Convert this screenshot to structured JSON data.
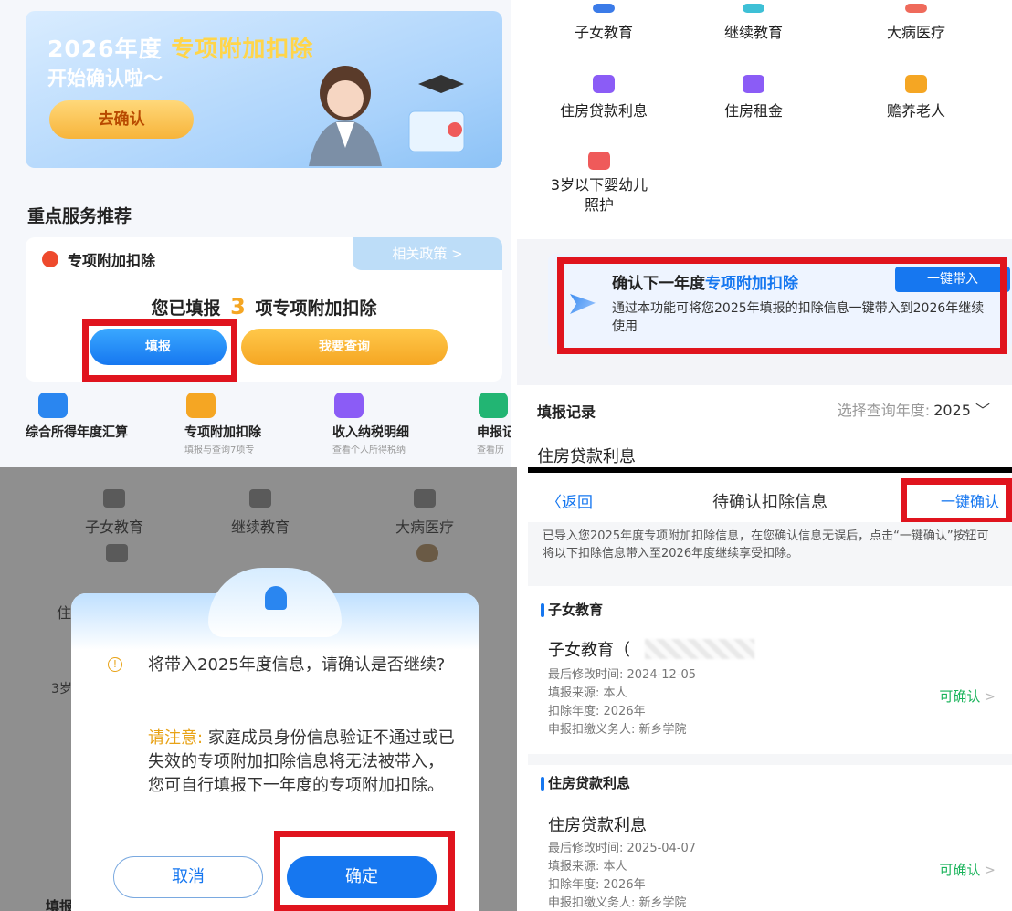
{
  "q1": {
    "banner_title_pre": "2026年度",
    "banner_title_hl": "专项附加扣除",
    "banner_sub": "开始确认啦～",
    "banner_btn": "去确认",
    "section_title": "重点服务推荐",
    "card_title": "专项附加扣除",
    "policy_link": "相关政策 >",
    "filled_pre": "您已填报",
    "filled_num": "3",
    "filled_post": "项专项附加扣除",
    "btn_fill": "填报",
    "btn_query": "我要查询",
    "tiles": [
      {
        "name": "综合所得年度汇算",
        "sub": "",
        "color": "#2a86f0"
      },
      {
        "name": "专项附加扣除",
        "sub": "填报与查询7项专",
        "color": "#f5a623"
      },
      {
        "name": "收入纳税明细",
        "sub": "查看个人所得税纳",
        "color": "#8b5cf6"
      },
      {
        "name": "申报记",
        "sub": "查看历",
        "color": "#22b573"
      }
    ]
  },
  "q2": {
    "cats": [
      "子女教育",
      "继续教育",
      "大病医疗",
      "住房贷款利息",
      "住房租金",
      "赡养老人",
      "3岁以下婴幼儿照护"
    ],
    "cat_colors": [
      "#3b7be8",
      "#3ec0d6",
      "#ef6a5b",
      "#8b5cf6",
      "#8b5cf6",
      "#f5a623",
      "#ef5a5a"
    ],
    "confirm_title_pre": "确认下一年度",
    "confirm_title_hl": "专项附加扣除",
    "confirm_btn": "一键带入",
    "confirm_desc": "通过本功能可将您2025年填报的扣除信息一键带入到2026年继续使用",
    "record_label": "填报记录",
    "year_label": "选择查询年度:",
    "year_value": "2025 ﹀",
    "house_label": "住房贷款利息"
  },
  "q3": {
    "cats": [
      "子女教育",
      "继续教育",
      "大病医疗"
    ],
    "dialog_text": "将带入2025年度信息，请确认是否继续?",
    "note_label": "请注意:",
    "note_text": "家庭成员身份信息验证不通过或已失效的专项附加扣除信息将无法被带入，您可自行填报下一年度的专项附加扣除。",
    "cancel": "取消",
    "ok": "确定",
    "peek_left": "住",
    "peek_3": "3岁",
    "peek_bottom": "填报"
  },
  "q4": {
    "back": "〈返回",
    "title": "待确认扣除信息",
    "one_click": "一键确认",
    "intro": "已导入您2025年度专项附加扣除信息，在您确认信息无误后，点击“一键确认”按钮可将以下扣除信息带入至2026年度继续享受扣除。",
    "items": [
      {
        "section": "子女教育",
        "title": "子女教育（",
        "modified": "最后修改时间: 2024-12-05",
        "source": "填报来源: 本人",
        "year": "扣除年度: 2026年",
        "agent": "申报扣缴义务人: 新乡学院",
        "status": "可确认",
        "chev": ">"
      },
      {
        "section": "住房贷款利息",
        "title": "住房贷款利息",
        "modified": "最后修改时间: 2025-04-07",
        "source": "填报来源: 本人",
        "year": "扣除年度: 2026年",
        "agent": "申报扣缴义务人: 新乡学院",
        "status": "可确认",
        "chev": ">"
      }
    ]
  }
}
